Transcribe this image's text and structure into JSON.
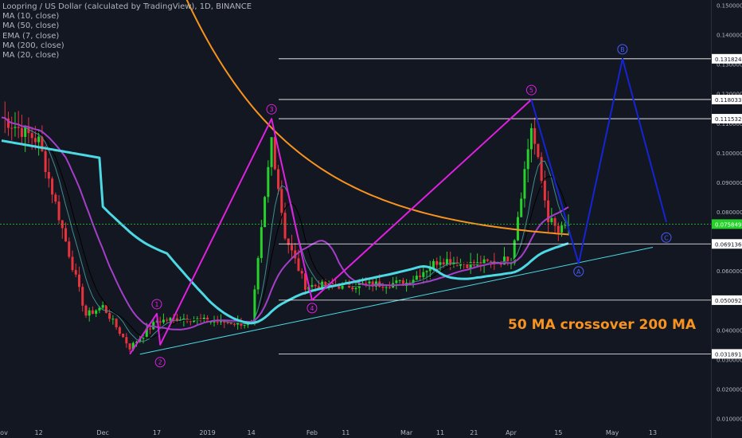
{
  "legend": {
    "title": "Loopring / US Dollar (calculated by TradingView), 1D, BINANCE",
    "items": [
      "MA (10, close)",
      "MA (50, close)",
      "EMA (7, close)",
      "MA (200, close)",
      "MA (20, close)"
    ]
  },
  "annotation": "50 MA crossover 200 MA",
  "colors": {
    "background": "#131722",
    "up": "#26d12b",
    "down": "#e8333d",
    "ma10": "#000000",
    "ma50": "#4dd9e3",
    "ema7": "#3f8f8c",
    "ma200": "#f7931e",
    "ma20": "#a43fc8",
    "wave_up": "#e020e0",
    "wave_down": "#1424d6",
    "current_price_line": "#26d12b"
  },
  "chart_data": {
    "type": "line",
    "title": "Loopring / US Dollar (calculated by TradingView), 1D, BINANCE",
    "yaxis_ticks": [
      "0.1500000",
      "0.1400000",
      "0.1300000",
      "0.1200000",
      "0.1100000",
      "0.1000000",
      "0.0900000",
      "0.0800000",
      "0.0700000",
      "0.0600000",
      "0.0500000",
      "0.0400000",
      "0.0300000",
      "0.0200000",
      "0.0100000"
    ],
    "ylim": [
      0.008,
      0.152
    ],
    "xaxis_ticks": [
      "Nov",
      "12",
      "Dec",
      "17",
      "2019",
      "14",
      "Feb",
      "11",
      "Mar",
      "11",
      "21",
      "Apr",
      "15",
      "May",
      "13"
    ],
    "xaxis_dates": [
      "2018-11-01",
      "2018-11-12",
      "2018-12-01",
      "2018-12-17",
      "2019-01-01",
      "2019-01-14",
      "2019-02-01",
      "2019-02-11",
      "2019-03-01",
      "2019-03-11",
      "2019-03-21",
      "2019-04-01",
      "2019-04-15",
      "2019-05-01",
      "2019-05-13"
    ],
    "price_labels": [
      {
        "label": "0.1318248",
        "value": 0.1318248
      },
      {
        "label": "0.1180331",
        "value": 0.1180331
      },
      {
        "label": "0.1115321",
        "value": 0.1115321
      },
      {
        "label": "0.0758495",
        "value": 0.0758495,
        "current": true
      },
      {
        "label": "0.0691360",
        "value": 0.069136
      },
      {
        "label": "0.0500923",
        "value": 0.0500923
      },
      {
        "label": "0.0318910",
        "value": 0.031891
      }
    ],
    "wave_points": [
      {
        "label": "1",
        "date": "2018-12-17",
        "value": 0.0455
      },
      {
        "label": "2",
        "date": "2018-12-18",
        "value": 0.0318
      },
      {
        "label": "3",
        "date": "2019-01-20",
        "value": 0.1115
      },
      {
        "label": "4",
        "date": "2019-02-01",
        "value": 0.0501
      },
      {
        "label": "5",
        "date": "2019-04-07",
        "value": 0.118
      },
      {
        "label": "A",
        "date": "2019-04-21",
        "value": 0.0625
      },
      {
        "label": "B",
        "date": "2019-05-04",
        "value": 0.1318
      },
      {
        "label": "C",
        "date": "2019-05-17",
        "value": 0.074
      }
    ],
    "wave_paths": {
      "impulse": [
        {
          "date": "2018-12-09",
          "value": 0.0318
        },
        {
          "date": "2018-12-17",
          "value": 0.0455
        },
        {
          "date": "2018-12-18",
          "value": 0.035
        },
        {
          "date": "2019-01-20",
          "value": 0.1115
        },
        {
          "date": "2019-02-01",
          "value": 0.0501
        },
        {
          "date": "2019-04-07",
          "value": 0.118
        }
      ],
      "correction": [
        {
          "date": "2019-04-07",
          "value": 0.118
        },
        {
          "date": "2019-04-21",
          "value": 0.0625
        },
        {
          "date": "2019-05-04",
          "value": 0.1318
        },
        {
          "date": "2019-05-17",
          "value": 0.0765
        }
      ]
    },
    "support_trendline": [
      {
        "date": "2018-12-12",
        "value": 0.0318
      },
      {
        "date": "2019-05-13",
        "value": 0.068
      }
    ],
    "ohlc_sample": [
      {
        "date": "2018-11-01",
        "value": 0.112
      },
      {
        "date": "2018-11-12",
        "value": 0.104
      },
      {
        "date": "2018-11-20",
        "value": 0.07
      },
      {
        "date": "2018-11-26",
        "value": 0.045
      },
      {
        "date": "2018-12-01",
        "value": 0.048
      },
      {
        "date": "2018-12-09",
        "value": 0.034
      },
      {
        "date": "2018-12-17",
        "value": 0.043
      },
      {
        "date": "2018-12-25",
        "value": 0.044
      },
      {
        "date": "2019-01-01",
        "value": 0.043
      },
      {
        "date": "2019-01-14",
        "value": 0.042
      },
      {
        "date": "2019-01-20",
        "value": 0.105
      },
      {
        "date": "2019-01-24",
        "value": 0.072
      },
      {
        "date": "2019-01-30",
        "value": 0.055
      },
      {
        "date": "2019-02-11",
        "value": 0.055
      },
      {
        "date": "2019-03-01",
        "value": 0.056
      },
      {
        "date": "2019-03-11",
        "value": 0.064
      },
      {
        "date": "2019-03-21",
        "value": 0.062
      },
      {
        "date": "2019-04-01",
        "value": 0.064
      },
      {
        "date": "2019-04-07",
        "value": 0.109
      },
      {
        "date": "2019-04-12",
        "value": 0.078
      },
      {
        "date": "2019-04-15",
        "value": 0.073
      },
      {
        "date": "2019-04-18",
        "value": 0.0758
      }
    ]
  }
}
